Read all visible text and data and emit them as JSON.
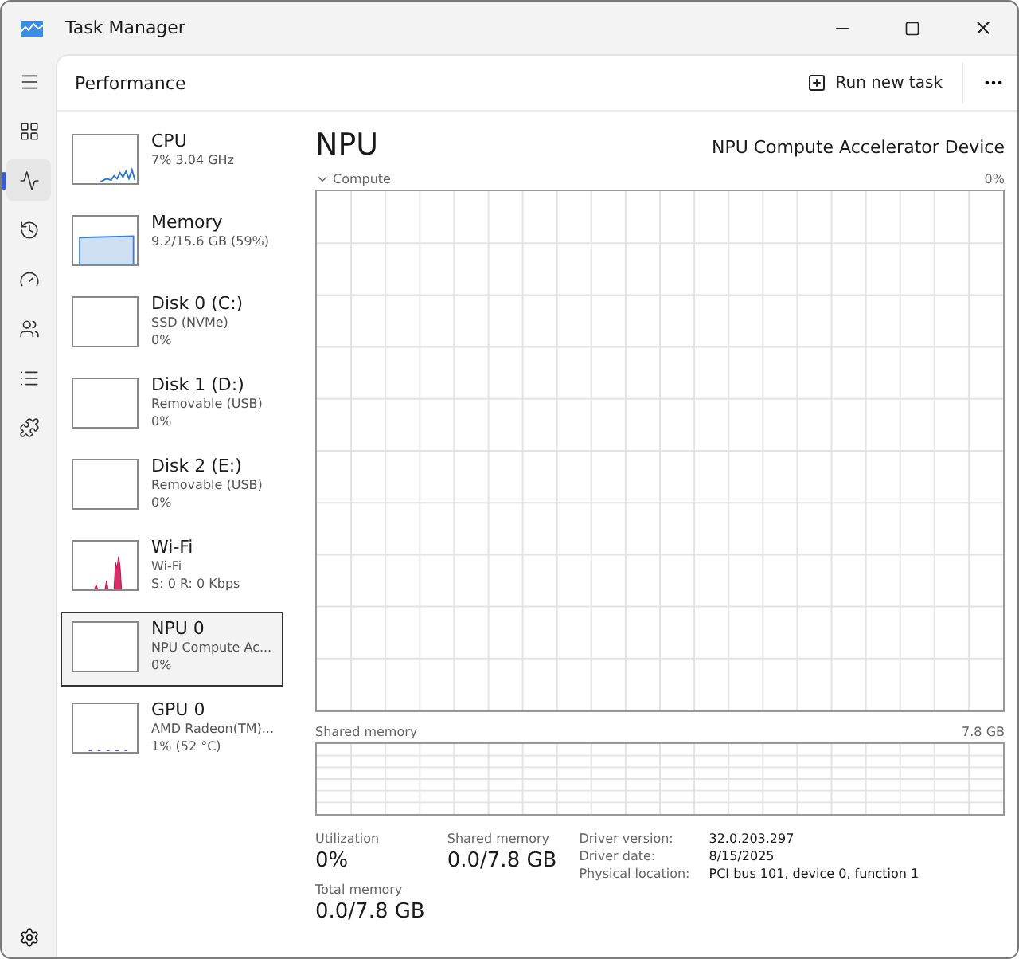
{
  "window": {
    "title": "Task Manager"
  },
  "nav": [
    {
      "kind": "menu",
      "selected": false
    },
    {
      "kind": "processes",
      "selected": false
    },
    {
      "kind": "performance",
      "selected": true
    },
    {
      "kind": "history",
      "selected": false
    },
    {
      "kind": "startup",
      "selected": false
    },
    {
      "kind": "users",
      "selected": false
    },
    {
      "kind": "details",
      "selected": false
    },
    {
      "kind": "services",
      "selected": false
    }
  ],
  "page": {
    "title": "Performance",
    "run_new_task": "Run new task"
  },
  "devices": [
    {
      "name": "CPU",
      "detail": "7% 3.04 GHz",
      "kind": "cpu",
      "selected": false
    },
    {
      "name": "Memory",
      "detail": "9.2/15.6 GB (59%)",
      "kind": "memory",
      "selected": false
    },
    {
      "name": "Disk 0 (C:)",
      "detail": "SSD (NVMe)",
      "value": "0%",
      "kind": "empty",
      "selected": false
    },
    {
      "name": "Disk 1 (D:)",
      "detail": "Removable (USB)",
      "value": "0%",
      "kind": "empty",
      "selected": false
    },
    {
      "name": "Disk 2 (E:)",
      "detail": "Removable (USB)",
      "value": "0%",
      "kind": "empty",
      "selected": false
    },
    {
      "name": "Wi-Fi",
      "detail": "Wi-Fi",
      "value": "S: 0 R: 0 Kbps",
      "kind": "wifi",
      "selected": false
    },
    {
      "name": "NPU 0",
      "detail": "NPU Compute Ac...",
      "value": "0%",
      "kind": "empty",
      "selected": true
    },
    {
      "name": "GPU 0",
      "detail": "AMD Radeon(TM)...",
      "value": "1% (52 °C)",
      "kind": "gpu",
      "selected": false
    }
  ],
  "detail": {
    "title": "NPU",
    "device": "NPU Compute Accelerator Device",
    "compute_label": "Compute",
    "compute_max": "0%",
    "shared_label": "Shared memory",
    "shared_max": "7.8 GB",
    "stats": [
      {
        "label": "Utilization",
        "value": "0%"
      },
      {
        "label": "Shared memory",
        "value": "0.0/7.8 GB"
      },
      {
        "label": "Total memory",
        "value": "0.0/7.8 GB"
      }
    ],
    "info": [
      {
        "label": "Driver version:",
        "value": "32.0.203.297"
      },
      {
        "label": "Driver date:",
        "value": "8/15/2025"
      },
      {
        "label": "Physical location:",
        "value": "PCI bus 101, device 0, function 1"
      }
    ]
  }
}
